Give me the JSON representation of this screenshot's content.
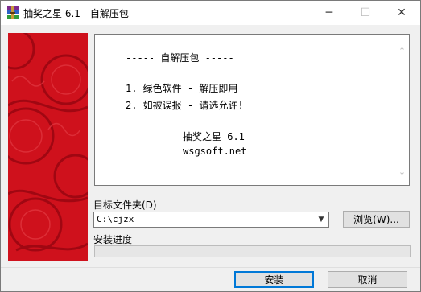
{
  "window": {
    "title": "抽奖之星 6.1 - 自解压包",
    "minimize_glyph": "─",
    "maximize_glyph": "☐",
    "close_glyph": "✕",
    "icon": "winrar-archive-icon"
  },
  "content": {
    "lines": [
      "----- 自解压包 -----",
      "1. 绿色软件 - 解压即用",
      "2. 如被误报 - 请选允许!",
      "抽奖之星 6.1",
      "wsgsoft.net"
    ],
    "scroll_up_glyph": "⌃",
    "scroll_down_glyph": "⌄"
  },
  "destination": {
    "label": "目标文件夹(D)",
    "value": "C:\\cjzx",
    "dropdown_glyph": "▼",
    "browse_label": "浏览(W)..."
  },
  "progress": {
    "label": "安装进度",
    "percent": 0
  },
  "footer": {
    "install_label": "安装",
    "cancel_label": "取消"
  },
  "colors": {
    "banner": "#d0101c",
    "default_button_border": "#0078d7"
  }
}
